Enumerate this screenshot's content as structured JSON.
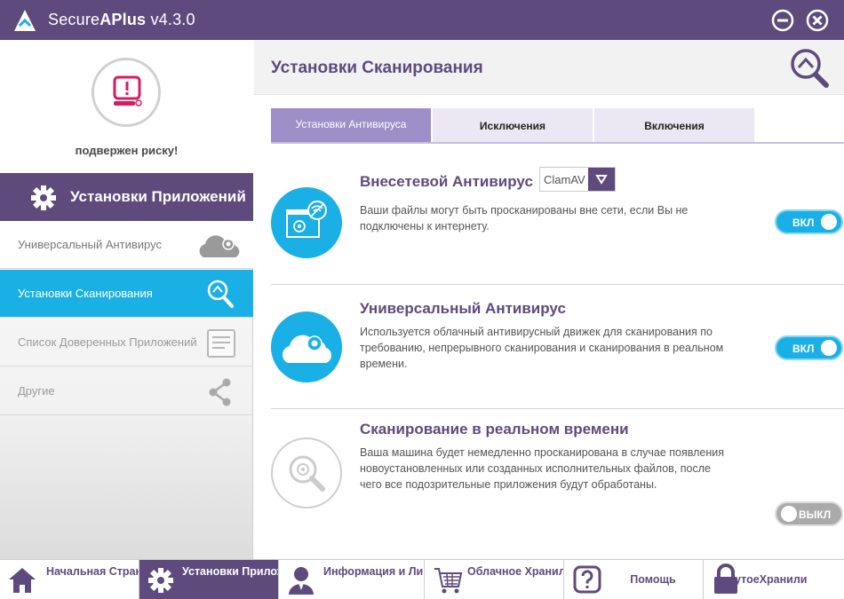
{
  "window": {
    "title_prefix": "Secure",
    "title_brand": "APlus",
    "title_version": " v4.3.0"
  },
  "sidebar": {
    "status_text": "подвержен риску!",
    "header": "Установки Приложений",
    "items": [
      {
        "label": "Универсальный Антивирус",
        "icon": "cloud-icon"
      },
      {
        "label": "Установки Сканирования",
        "icon": "search-icon"
      },
      {
        "label": "Список Доверенных Приложений",
        "icon": "document-icon"
      },
      {
        "label": "Другие",
        "icon": "share-icon"
      }
    ]
  },
  "main": {
    "title": "Установки Сканирования",
    "tabs": [
      {
        "label": "Установки Антивируса"
      },
      {
        "label": "Исключения"
      },
      {
        "label": "Включения"
      }
    ],
    "sections": [
      {
        "title": "Внесетевой Антивирус",
        "engine": "ClamAV",
        "description": "Ваши файлы могут быть просканированы вне сети, если Вы не подключены к интернету.",
        "toggle": "ВКЛ",
        "enabled": true
      },
      {
        "title": "Универсальный Антивирус",
        "description": "Используется облачный антивирусный движек для сканирования по требованию, непрерывного сканирования и сканирования в реальном времени.",
        "toggle": "ВКЛ",
        "enabled": true
      },
      {
        "title": "Сканирование в реальном времени",
        "description": "Ваша машина будет немедленно просканирована в случае появления новоустановленных или созданных исполнительных файлов, после чего все подозрительные приложения будут обработаны.",
        "toggle": "ВЫКЛ",
        "enabled": false
      }
    ]
  },
  "bottom_nav": [
    {
      "label": "Начальная Страница",
      "icon": "home-icon"
    },
    {
      "label": "Установки Приложений",
      "icon": "gear-icon"
    },
    {
      "label": "Информация и Лицензии",
      "icon": "user-icon"
    },
    {
      "label": "Облачное Хранилище",
      "icon": "cart-icon"
    },
    {
      "label": "Помощь",
      "icon": "help-icon"
    },
    {
      "label": "мкнутоеХранили",
      "icon": "lock-icon"
    }
  ],
  "colors": {
    "primary": "#5e4a7d",
    "accent": "#1ab0e6",
    "alert": "#d81b60",
    "tab_active": "#9e8fc9"
  }
}
